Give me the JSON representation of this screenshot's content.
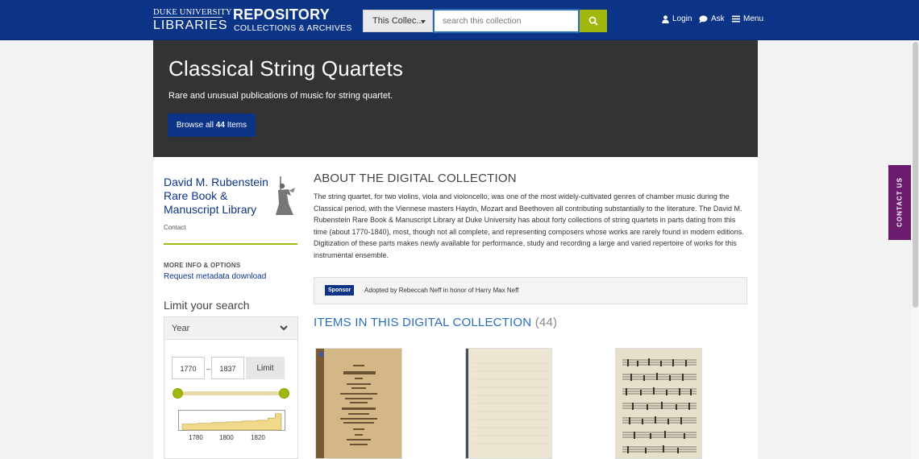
{
  "header": {
    "logo_top": "DUKE UNIVERSITY",
    "logo_bottom": "LIBRARIES",
    "repo_title": "REPOSITORY",
    "repo_subtitle": "COLLECTIONS & ARCHIVES",
    "scope_label": "This Collec...",
    "search_placeholder": "search this collection",
    "login_label": "Login",
    "ask_label": "Ask",
    "menu_label": "Menu",
    "brand_color": "#0b3486",
    "accent_color": "#a1b70d"
  },
  "hero": {
    "title": "Classical String Quartets",
    "subtitle": "Rare and unusual publications of music for string quartet.",
    "browse_prefix": "Browse all",
    "browse_count": "44",
    "browse_suffix": "Items"
  },
  "sidebar": {
    "library_name": "David M. Rubenstein Rare Book & Manuscript Library",
    "contact_label": "Contact",
    "more_info_label": "MORE INFO & OPTIONS",
    "request_link": "Request metadata download",
    "limit_title": "Limit your search",
    "year_label": "Year",
    "year_from": "1770",
    "year_to": "1837",
    "limit_button": "Limit",
    "histogram_ticks": [
      "1780",
      "1800",
      "1820"
    ]
  },
  "main": {
    "about_title": "ABOUT THE DIGITAL COLLECTION",
    "about_text": "The string quartet, for two violins, viola and violoncello, was one of the most widely-cultivated genres of chamber music during the Classical period, with the Viennese masters Haydn, Mozart and Beethoven all contributing substantially to the literature. The David M. Rubenstein Rare Book & Manuscript Library at Duke University has about forty collections of string quartets in parts dating from this time (about 1770-1840), most, though not all complete, and representing composers whose works are rarely found in modern editions. Digitization of these parts makes newly available for performance, study and recording a large and varied repertoire of works for this instrumental ensemble.",
    "sponsor_badge": "Sponsor",
    "sponsor_text": "Adopted by Rebeccah Neff in honor of Harry Max Neff",
    "items_title": "ITEMS IN THIS DIGITAL COLLECTION",
    "items_count": "(44)"
  },
  "contact_tab": "CONTACT US"
}
